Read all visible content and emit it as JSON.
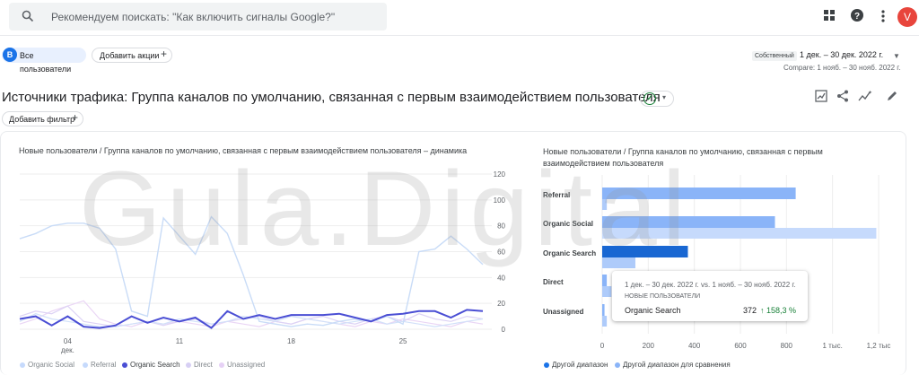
{
  "search": {
    "placeholder": "Рекомендуем поискать: \"Как включить сигналы Google?\""
  },
  "topbar": {
    "avatar_letter": "V"
  },
  "segments": {
    "all_users_badge": "B",
    "all_users": "Все пользователи",
    "add_action": "Добавить акции"
  },
  "daterange": {
    "type": "Собственный",
    "range": "1 дек. – 30 дек. 2022 г.",
    "compare": "Compare: 1 нояб. – 30 нояб. 2022 г."
  },
  "page": {
    "title": "Источники трафика: Группа каналов по умолчанию, связанная с первым взаимодействием пользователя",
    "add_filter": "Добавить фильтр"
  },
  "line_chart": {
    "title": "Новые пользователи / Группа каналов по умолчанию, связанная с первым взаимодействием пользователя – динамика",
    "y_ticks": [
      "120",
      "100",
      "80",
      "60",
      "40",
      "20",
      "0"
    ],
    "x_ticks": [
      "04",
      "дек.",
      "11",
      "18",
      "25"
    ],
    "legend": [
      "Organic Social",
      "Referral",
      "Organic Search",
      "Direct",
      "Unassigned"
    ]
  },
  "bar_chart": {
    "title": "Новые пользователи / Группа каналов по умолчанию, связанная с первым взаимодействием пользователя",
    "x_ticks": [
      "0",
      "200",
      "400",
      "600",
      "800",
      "1 тыс.",
      "1,2 тыс"
    ],
    "legend": [
      "Другой диапазон",
      "Другой диапазон для сравнения"
    ]
  },
  "tooltip": {
    "range": "1 дек. – 30 дек. 2022 г. vs. 1 нояб. – 30 нояб. 2022 г.",
    "metric": "НОВЫЕ ПОЛЬЗОВАТЕЛИ",
    "name": "Organic Search",
    "value": "372",
    "change": "↑ 158,3 %"
  },
  "watermark": "Gula.Digital",
  "colors": {
    "primary": "#1a73e8",
    "series_dark": "#4a4ed4",
    "compare_light": "#aecbfa",
    "positive": "#188038"
  },
  "chart_data": [
    {
      "type": "line",
      "title": "Новые пользователи / Группа каналов по умолчанию, связанная с первым взаимодействием пользователя – динамика",
      "x": [
        1,
        2,
        3,
        4,
        5,
        6,
        7,
        8,
        9,
        10,
        11,
        12,
        13,
        14,
        15,
        16,
        17,
        18,
        19,
        20,
        21,
        22,
        23,
        24,
        25,
        26,
        27,
        28,
        29,
        30
      ],
      "ylim": [
        0,
        120
      ],
      "series": [
        {
          "name": "Organic Search",
          "values": [
            8,
            10,
            3,
            10,
            2,
            1,
            3,
            10,
            5,
            9,
            6,
            9,
            1,
            14,
            8,
            11,
            8,
            11,
            11,
            11,
            12,
            9,
            6,
            11,
            12,
            14,
            14,
            9,
            15,
            14
          ]
        },
        {
          "name": "Referral",
          "values": [
            70,
            74,
            80,
            82,
            82,
            78,
            62,
            14,
            10,
            86,
            72,
            58,
            87,
            74,
            42,
            6,
            4,
            2,
            4,
            3,
            6,
            8,
            6,
            10,
            4,
            60,
            62,
            72,
            62,
            50
          ]
        },
        {
          "name": "Organic Social",
          "values": [
            6,
            12,
            8,
            6,
            4,
            2,
            2,
            4,
            6,
            4,
            8,
            6,
            4,
            6,
            10,
            8,
            6,
            10,
            8,
            6,
            4,
            6,
            8,
            4,
            6,
            4,
            2,
            4,
            6,
            8
          ]
        },
        {
          "name": "Direct",
          "values": [
            10,
            14,
            12,
            18,
            6,
            4,
            2,
            4,
            6,
            3,
            6,
            8,
            4,
            6,
            8,
            10,
            6,
            4,
            8,
            10,
            6,
            4,
            8,
            10,
            6,
            12,
            8,
            6,
            10,
            8
          ]
        },
        {
          "name": "Unassigned",
          "values": [
            4,
            8,
            14,
            18,
            22,
            8,
            4,
            2,
            6,
            4,
            6,
            4,
            2,
            6,
            4,
            2,
            6,
            4,
            8,
            6,
            4,
            2,
            6,
            4,
            8,
            6,
            4,
            2,
            6,
            4
          ]
        }
      ]
    },
    {
      "type": "bar",
      "title": "Новые пользователи / Группа каналов по умолчанию, связанная с первым взаимодействием пользователя",
      "categories": [
        "Referral",
        "Organic Social",
        "Organic Search",
        "Direct",
        "Unassigned"
      ],
      "xlim": [
        0,
        1200
      ],
      "series": [
        {
          "name": "Другой диапазон",
          "values": [
            840,
            750,
            372,
            20,
            10
          ]
        },
        {
          "name": "Другой диапазон для сравнения",
          "values": [
            20,
            1190,
            144,
            40,
            20
          ]
        }
      ]
    }
  ]
}
